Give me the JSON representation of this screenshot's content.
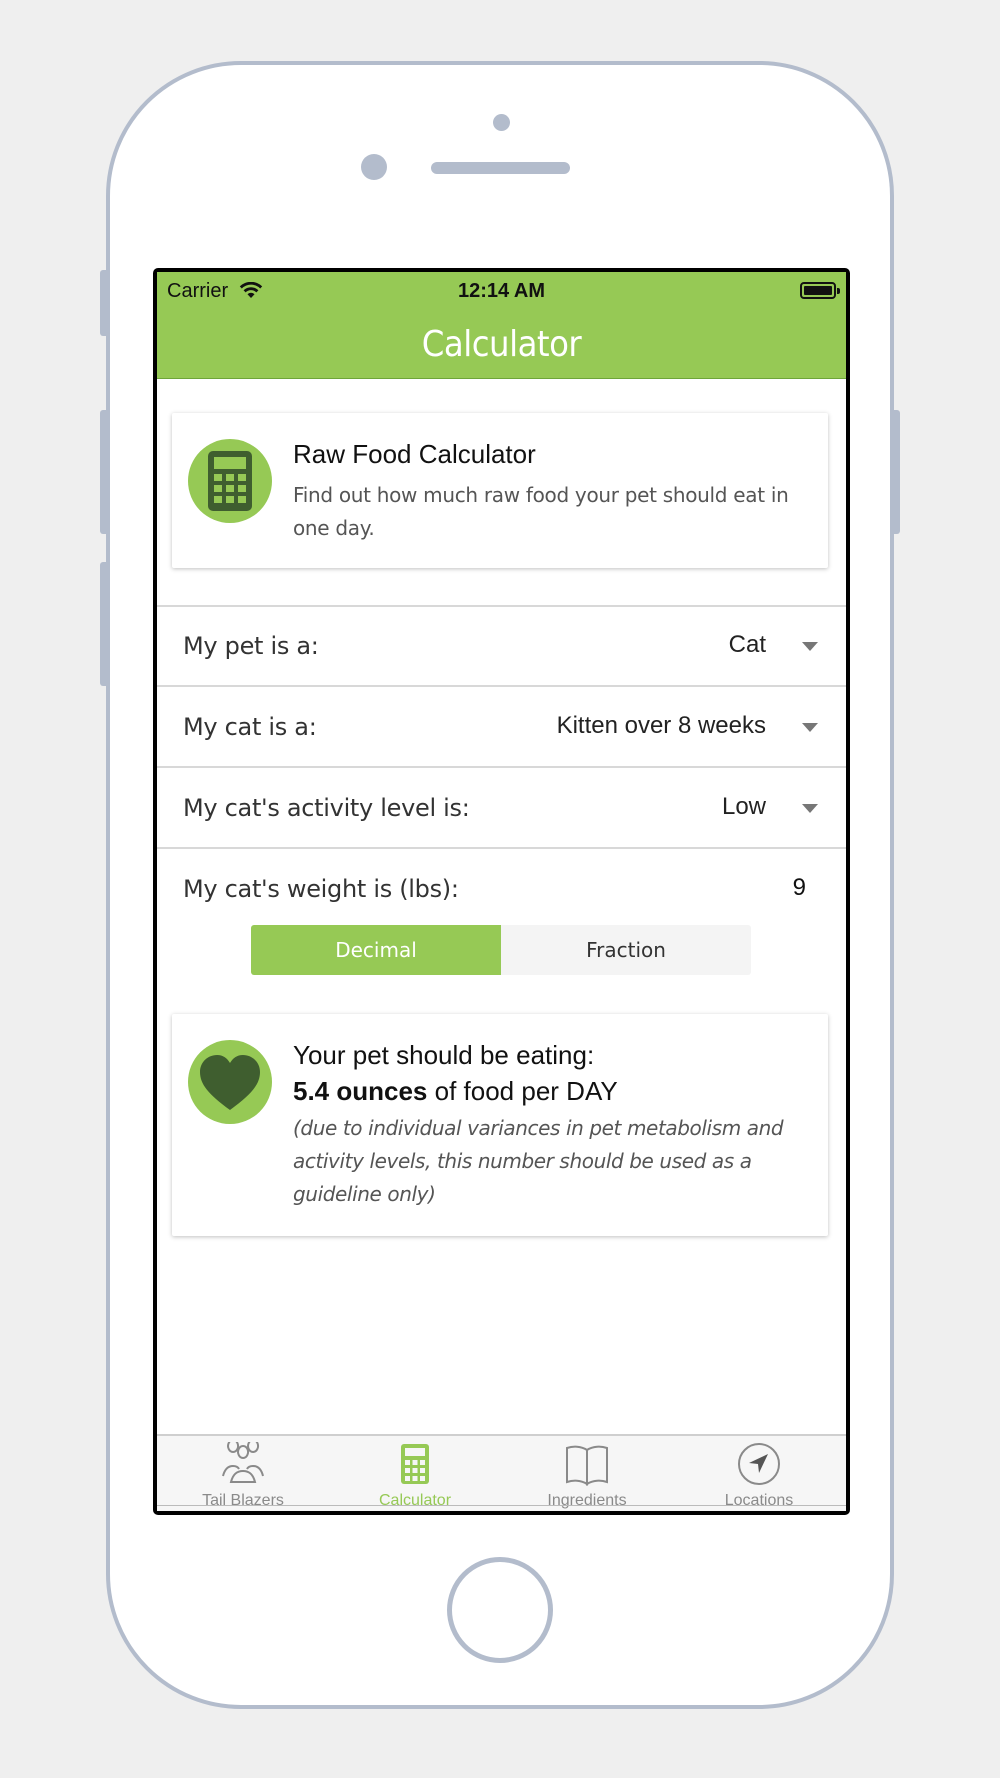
{
  "status_bar": {
    "carrier": "Carrier",
    "time": "12:14 AM"
  },
  "nav": {
    "title": "Calculator"
  },
  "intro_card": {
    "icon": "calculator-icon",
    "title": "Raw Food Calculator",
    "description": "Find out how much raw food your pet should eat in one day."
  },
  "form": {
    "pet_type": {
      "label": "My pet is a:",
      "value": "Cat"
    },
    "cat_age": {
      "label": "My cat is a:",
      "value": "Kitten over 8 weeks"
    },
    "activity": {
      "label": "My cat's activity level is:",
      "value": "Low"
    },
    "weight": {
      "label": "My cat's weight is (lbs):",
      "value": "9"
    },
    "format_toggle": {
      "decimal": "Decimal",
      "fraction": "Fraction",
      "selected": "Decimal"
    }
  },
  "result_card": {
    "icon": "heart-icon",
    "line1": "Your pet should be eating:",
    "amount": "5.4 ounces",
    "amount_suffix": " of food per DAY",
    "note": "(due to individual variances in pet metabolism and activity levels, this number should be used as a guideline only)"
  },
  "tabs": [
    {
      "label": "Tail Blazers",
      "icon": "users-icon",
      "active": false
    },
    {
      "label": "Calculator",
      "icon": "calculator-icon",
      "active": true
    },
    {
      "label": "Ingredients",
      "icon": "book-icon",
      "active": false
    },
    {
      "label": "Locations",
      "icon": "compass-icon",
      "active": false
    }
  ],
  "colors": {
    "brand_green": "#96c955",
    "icon_dark_green": "#3f5e2f",
    "phone_frame": "#b3bccc"
  }
}
